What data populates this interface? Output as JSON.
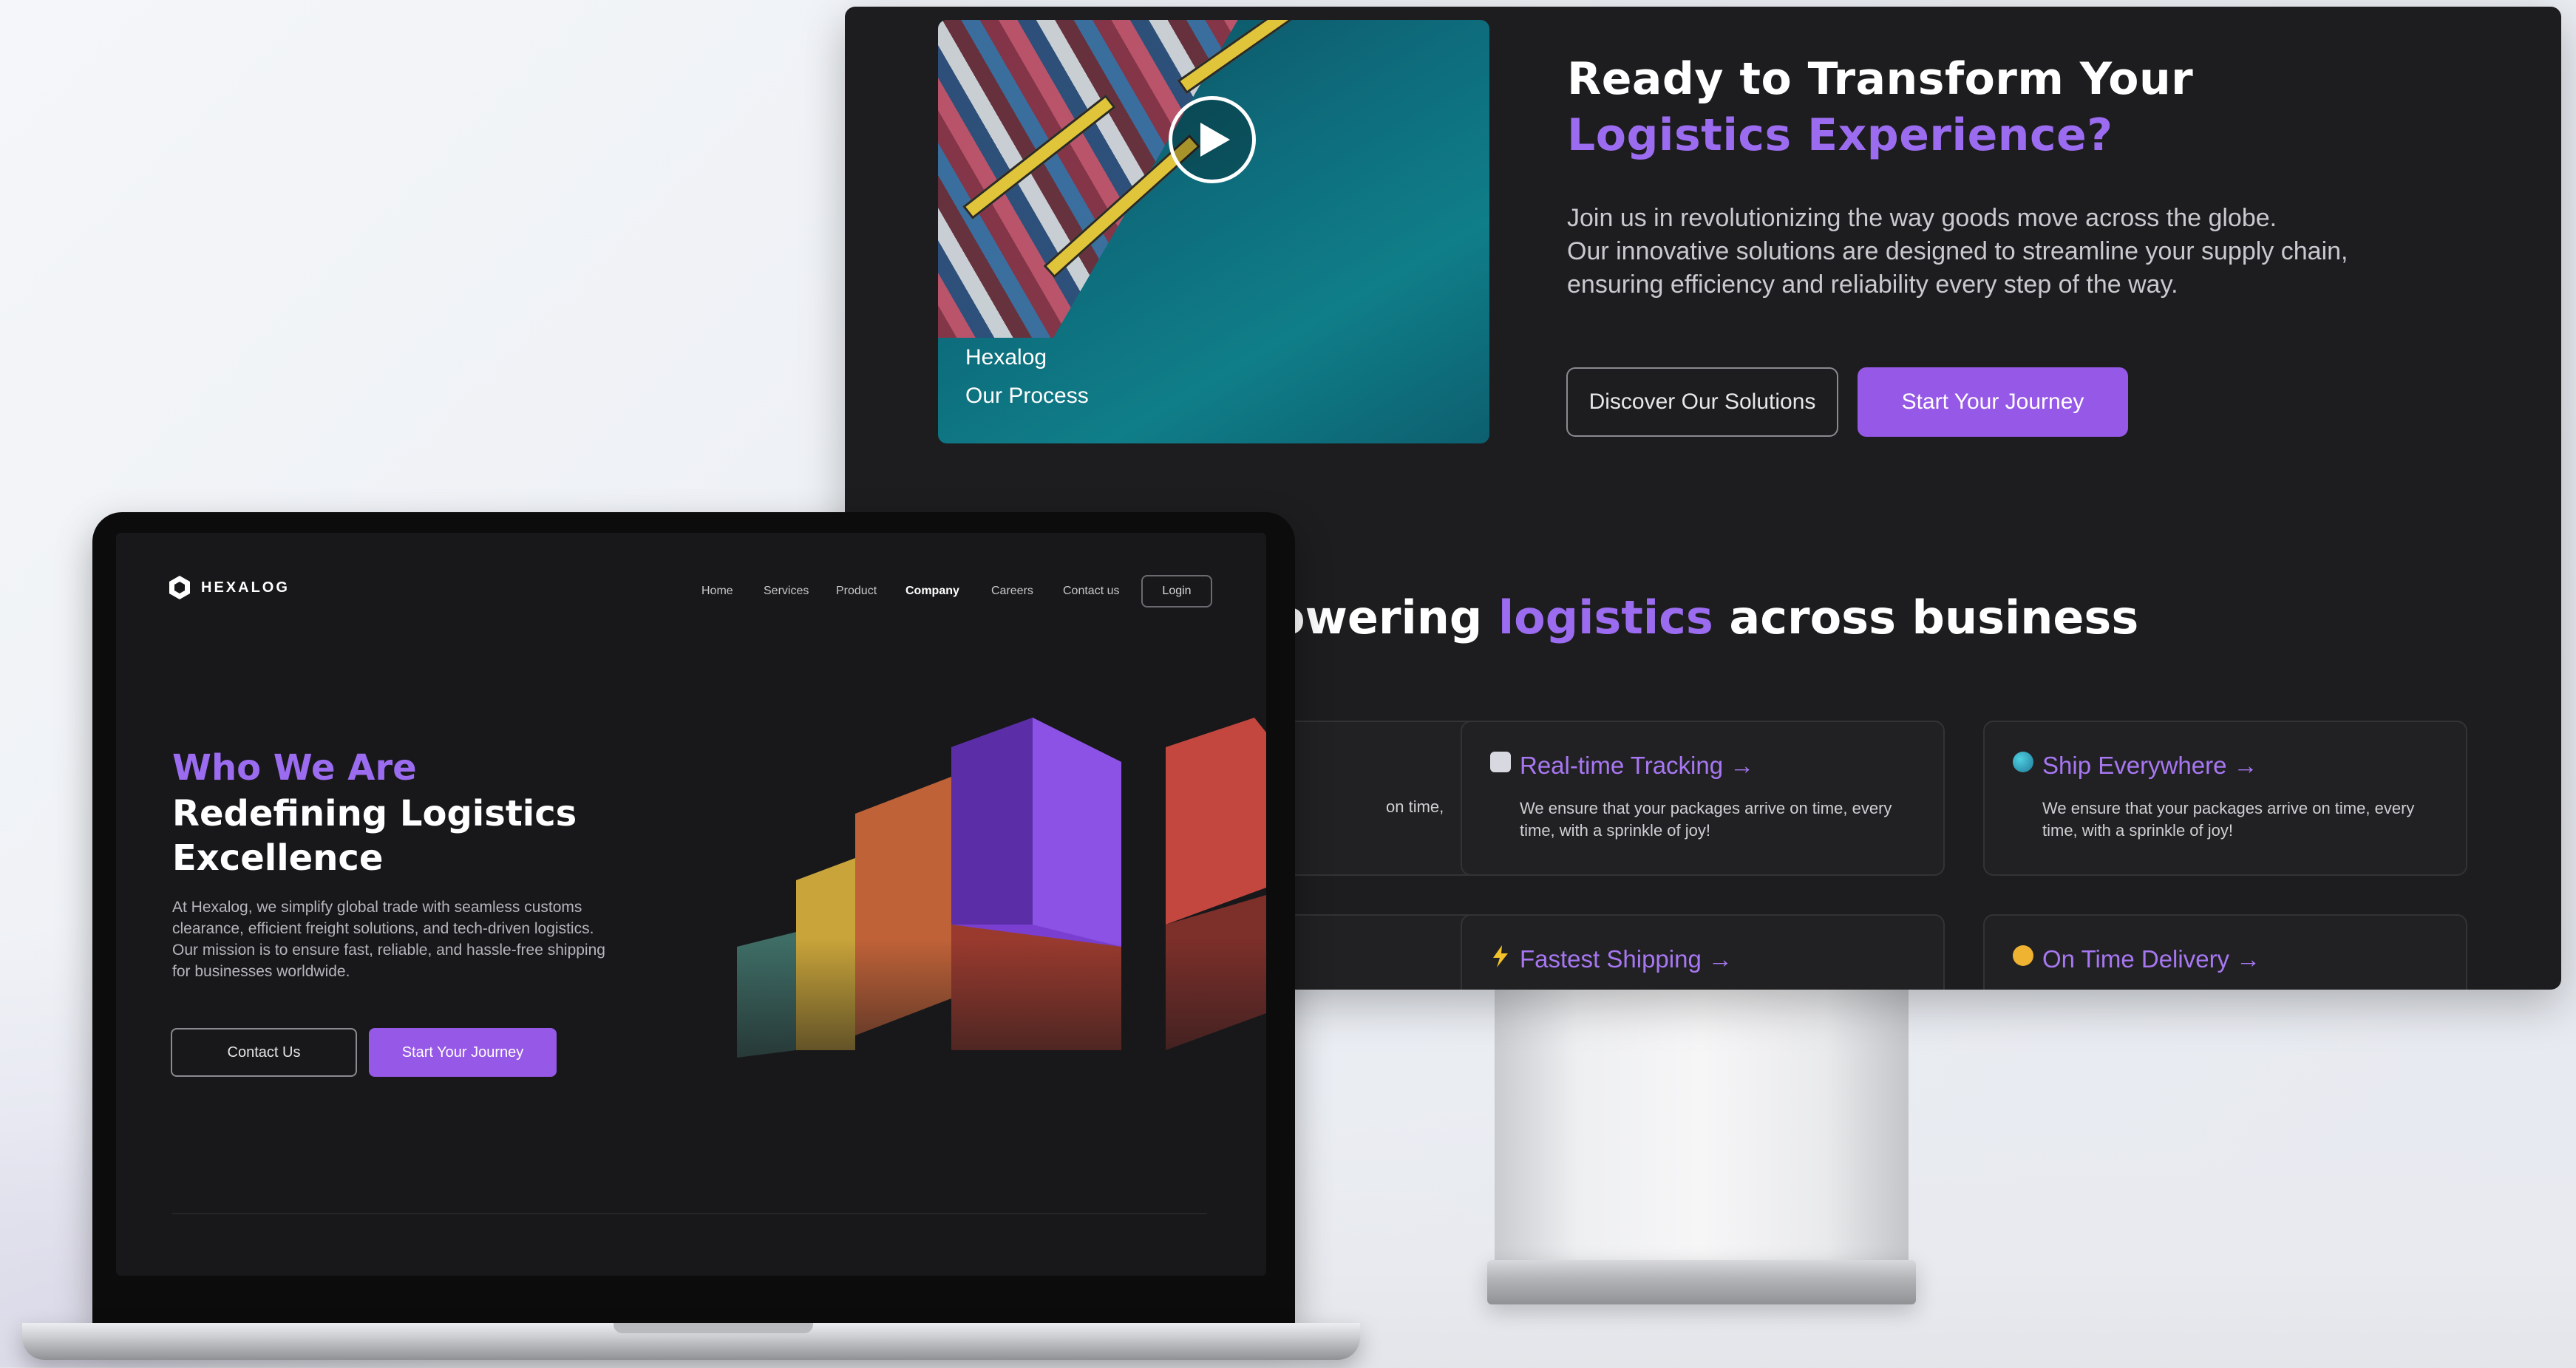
{
  "monitor": {
    "video": {
      "brand": "Hexalog",
      "caption": "Our Process",
      "play_icon": "play-icon"
    },
    "heading": {
      "line1": "Ready to Transform Your",
      "line2": "Logistics Experience?"
    },
    "description": {
      "line1": "Join us in revolutionizing the way goods move across the globe.",
      "line2": "Our innovative solutions are designed to streamline your supply chain,",
      "line3": "ensuring efficiency and reliability every step of the way."
    },
    "buttons": {
      "discover": "Discover Our Solutions",
      "start": "Start Your Journey"
    },
    "section": {
      "prefix": "owering",
      "highlight": "logistics",
      "suffix": "across business"
    },
    "cards": [
      {
        "title": "Real-time Tracking →",
        "desc": "We ensure that your packages arrive on time, every time, with a sprinkle of joy!",
        "icon": "tracking-icon"
      },
      {
        "title": "Ship Everywhere →",
        "desc": "We ensure that your packages arrive on time, every time, with a sprinkle of joy!",
        "icon": "globe-icon"
      },
      {
        "title": "Fastest Shipping →",
        "icon": "lightning-icon"
      },
      {
        "title": "On Time Delivery →",
        "icon": "clock-icon"
      }
    ],
    "partial_card_text": "on time,"
  },
  "laptop": {
    "logo": "HEXALOG",
    "nav": [
      "Home",
      "Services",
      "Product",
      "Company",
      "Careers",
      "Contact us"
    ],
    "nav_active": "Company",
    "login": "Login",
    "hero": {
      "eyebrow": "Who We Are",
      "line1": "Redefining Logistics",
      "line2": "Excellence",
      "desc": "At Hexalog, we simplify global trade with seamless customs clearance, efficient freight solutions, and tech-driven logistics. Our mission is to ensure fast, reliable, and hassle-free shipping for businesses worldwide."
    },
    "buttons": {
      "contact": "Contact Us",
      "start": "Start Your Journey"
    }
  },
  "colors": {
    "accent": "#9658e6",
    "accent_text": "#9b6cf0",
    "screen_bg": "#1d1d1f"
  }
}
